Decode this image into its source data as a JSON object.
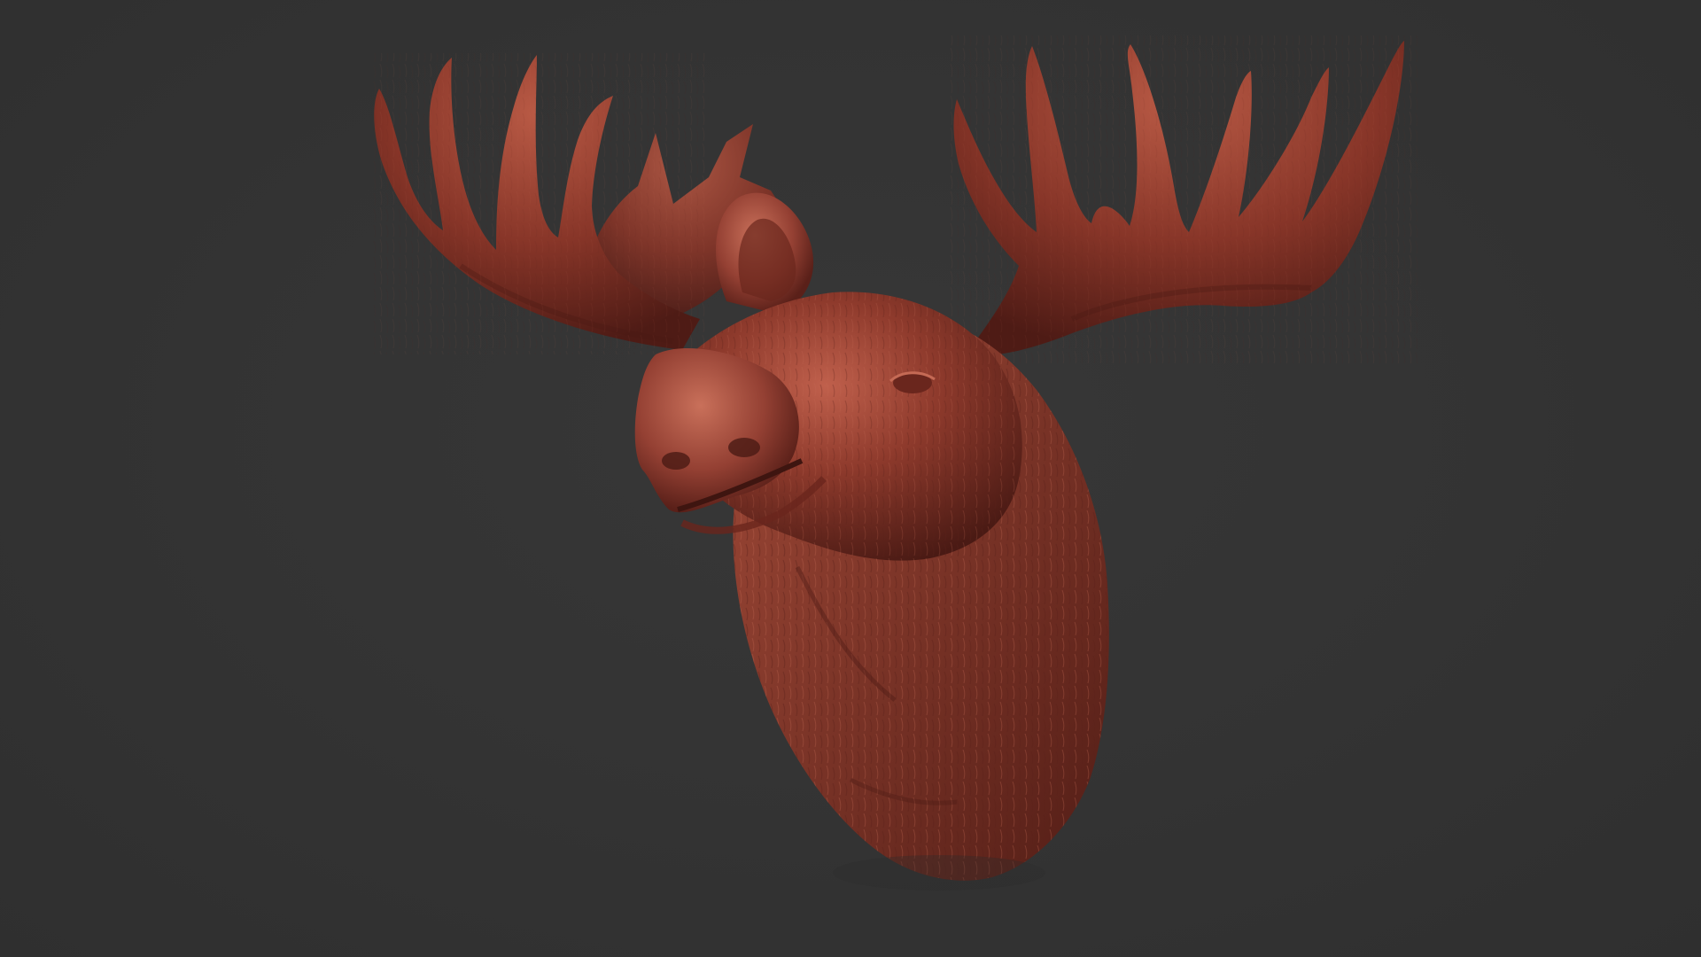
{
  "scene": {
    "subject_icon": "moose-head-sculpt-icon",
    "colors": {
      "background": "#333333",
      "clay_base": "#8e3a2c",
      "clay_light": "#c0604c",
      "clay_shadow": "#4a1a14"
    }
  }
}
